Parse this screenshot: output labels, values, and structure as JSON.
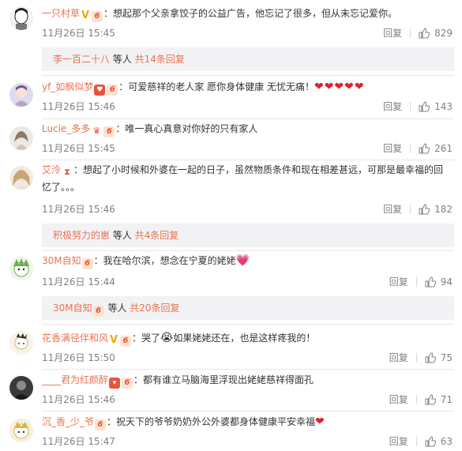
{
  "colors": {
    "link": "#eb7350",
    "meta": "#808080",
    "reply_bg": "#f2f2f5"
  },
  "comments": [
    {
      "user": "一只村草",
      "text": "：想起那个父亲拿饺子的公益广告，他忘记了很多，但从未忘记爱你。",
      "time": "11月26日 15:45",
      "reply": "回复",
      "likes": "829",
      "replies": {
        "user": "李一百二十八",
        "mid": " 等人 ",
        "count": "共14条回复"
      }
    },
    {
      "user": "yf_如枫似梦",
      "text": "：可爱慈祥的老人家 愿你身体健康 无忧无痛！",
      "time": "11月26日 15:46",
      "reply": "回复",
      "likes": "143"
    },
    {
      "user": "Lucie_多多",
      "text": "：唯一真心真意对你好的只有家人",
      "time": "11月26日 15:45",
      "reply": "回复",
      "likes": "261"
    },
    {
      "user": "艾泠",
      "text_line1": "：想起了小时候和外婆在一起的日子，虽然物质条件和现在相差甚远，可那是最幸福的回",
      "text_line2": "忆了。。。",
      "time": "11月26日 15:46",
      "reply": "回复",
      "likes": "182",
      "replies": {
        "user": "积极努力的崽",
        "mid": " 等人 ",
        "count": "共4条回复"
      }
    },
    {
      "user": "30M自知",
      "text": "：我在哈尔滨，想念在宁夏的姥姥",
      "time": "11月26日 15:44",
      "reply": "回复",
      "likes": "94",
      "replies": {
        "user": "30M自知",
        "mid": " 等人 ",
        "count": "共20条回复"
      }
    },
    {
      "user": "花香满径伴和风",
      "text_a": "：哭了",
      "text_b": "如果姥姥还在，也是这样疼我的！",
      "time": "11月26日 15:50",
      "reply": "回复",
      "likes": "75"
    },
    {
      "user": "____君为红颜醉",
      "text": "：都有谁立马脑海里浮现出姥姥慈祥得面孔",
      "time": "11月26日 15:46",
      "reply": "回复",
      "likes": "71"
    },
    {
      "user": "沉_香_少_爷",
      "text": "：祝天下的爷爷奶奶外公外婆都身体健康平安幸福",
      "time": "11月26日 15:47",
      "reply": "回复",
      "likes": "63"
    }
  ]
}
